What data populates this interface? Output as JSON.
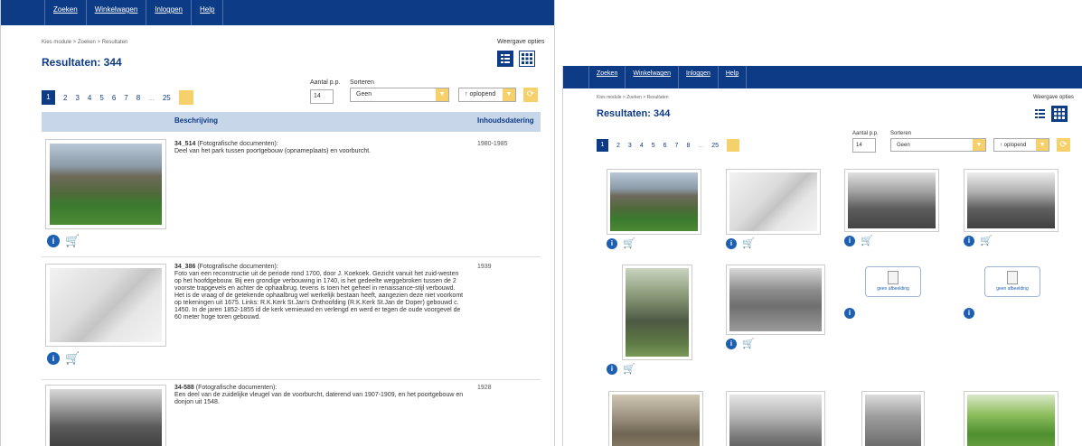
{
  "nav": {
    "items": [
      "Zoeken",
      "Winkelwagen",
      "Inloggen",
      "Help"
    ]
  },
  "breadcrumb": "Kies module > Zoeken > Resultaten",
  "display_options_label": "Weergave opties",
  "results_title": "Resultaten: 344",
  "pagination": {
    "current": "1",
    "pages": [
      "2",
      "3",
      "4",
      "5",
      "6",
      "7",
      "8"
    ],
    "ellipsis": "...",
    "last": "25"
  },
  "per_page": {
    "label": "Aantal p.p.",
    "value": "14"
  },
  "sort": {
    "label": "Sorteren",
    "value": "Geen",
    "order": "↑ oplopend"
  },
  "table": {
    "col_description": "Beschrijving",
    "col_date": "Inhoudsdatering"
  },
  "records": [
    {
      "id": "34_514",
      "type": "(Fotografische documenten):",
      "text": "Deel van het park tussen poortgebouw (opnameplaats) en voorburcht.",
      "date": "1980-1985"
    },
    {
      "id": "34_386",
      "type": "(Fotografische documenten):",
      "text": "Foto van een reconstructie uit de periode rond 1700, door J. Koekoek. Gezicht vanuit het zuid-westen op het hoofdgebouw. Bij een grondige verbouwing in 1740, is het gedeelte weggebroken tussen de 2 voorste trapgevels en achter de ophaalbrug. tevens is toen het geheel in renaissance-stijl verbouwd. Het is de vraag of de getekende ophaalbrug wel werkelijk bestaan heeft, aangezien deze niet voorkomt op tekeningen uit 1675. Links: R.K.Kerk St.Jan's Onthoofding (R.K.Kerk St.Jan de Doper) gebouwd c. 1450. In de jaren 1852-1855 id de kerk vernieuwd en verlengd en werd er tegen de oude voorgevel de 60 meter hoge toren gebouwd.",
      "date": "1939"
    },
    {
      "id": "34-588",
      "type": "(Fotografische documenten):",
      "text": "Een deel van de zuidelijke vleugel van de voorburcht, daterend van 1907-1909, en het poortgebouw en donjon uit 1548.",
      "date": "1928"
    }
  ],
  "no_image_label": "geen afbeelding",
  "colors": {
    "navy": "#0d3b86",
    "accent_yellow": "#f5d06b",
    "header_blue": "#c8d6e9"
  },
  "icons": [
    "info-icon",
    "cart-icon",
    "list-view-icon",
    "grid-view-icon",
    "refresh-icon",
    "chevron-down-icon"
  ]
}
